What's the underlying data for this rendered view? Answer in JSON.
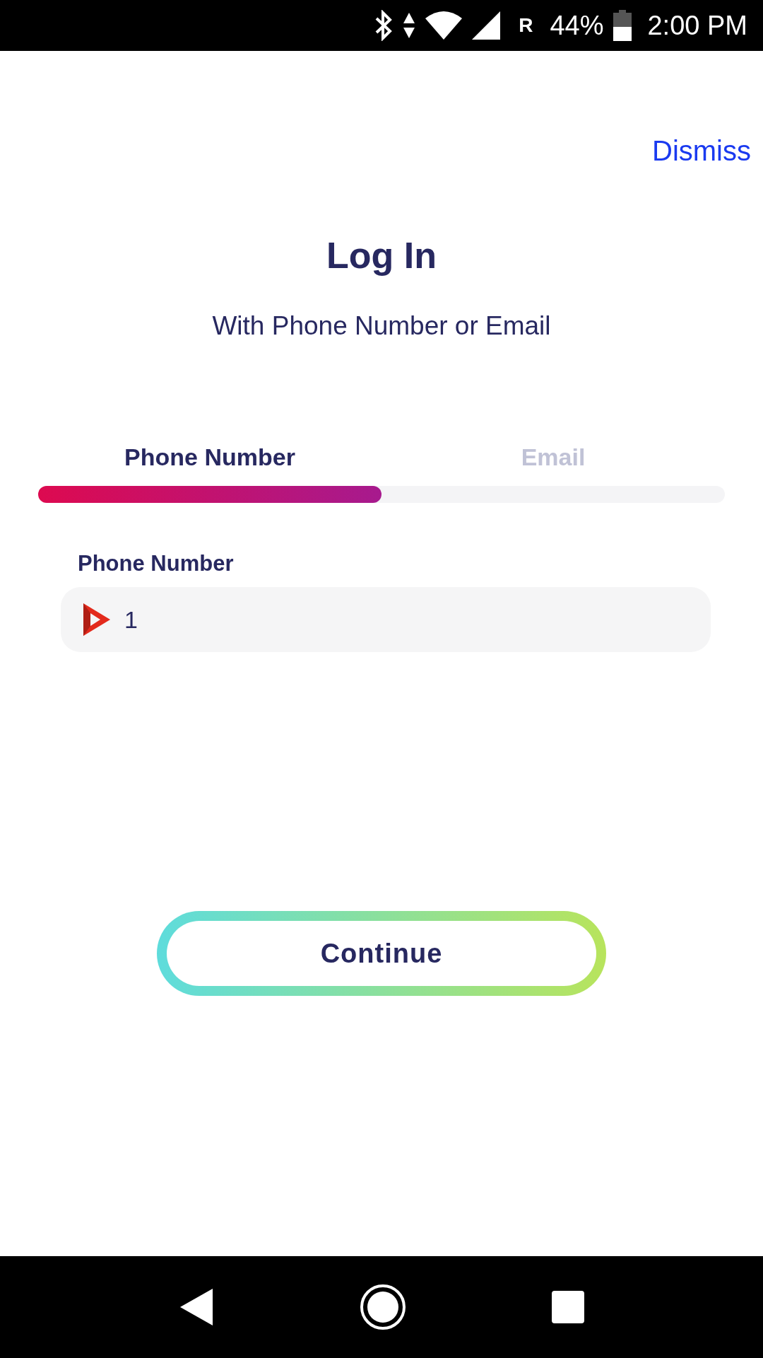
{
  "status_bar": {
    "network": "R",
    "battery": "44%",
    "time": "2:00 PM"
  },
  "dismiss": "Dismiss",
  "title": "Log In",
  "subtitle": "With Phone Number or Email",
  "tabs": [
    {
      "label": "Phone Number",
      "selected": true
    },
    {
      "label": "Email",
      "selected": false
    }
  ],
  "field": {
    "label": "Phone Number",
    "value": "1"
  },
  "continue_button": "Continue"
}
